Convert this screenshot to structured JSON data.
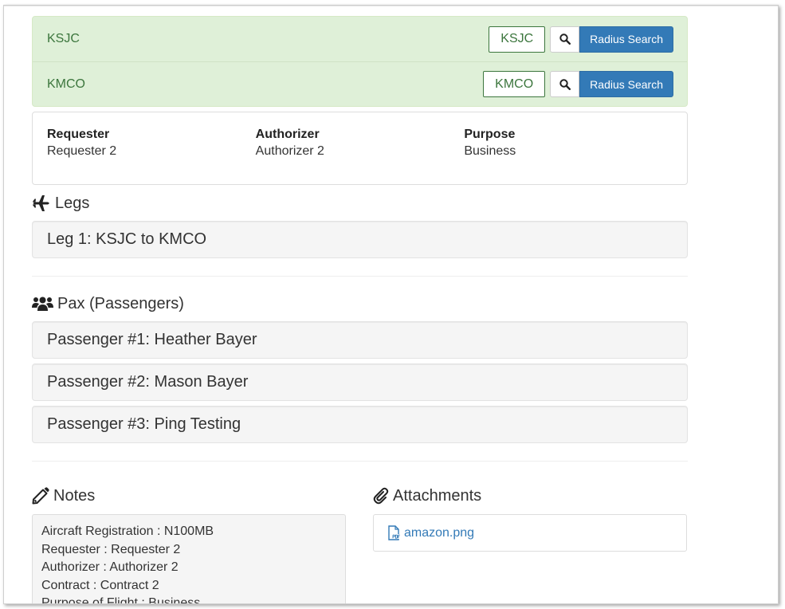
{
  "airports": [
    {
      "code": "KSJC",
      "input_value": "KSJC",
      "radius_label": "Radius Search"
    },
    {
      "code": "KMCO",
      "input_value": "KMCO",
      "radius_label": "Radius Search"
    }
  ],
  "trip_info": {
    "requester_label": "Requester",
    "requester_value": "Requester 2",
    "authorizer_label": "Authorizer",
    "authorizer_value": "Authorizer 2",
    "purpose_label": "Purpose",
    "purpose_value": "Business"
  },
  "legs": {
    "heading": "Legs",
    "icon": "plane-icon",
    "items": [
      "Leg 1: KSJC to KMCO"
    ]
  },
  "pax": {
    "heading": "Pax (Passengers)",
    "icon": "users-icon",
    "items": [
      "Passenger #1: Heather Bayer",
      "Passenger #2: Mason Bayer",
      "Passenger #3: Ping Testing"
    ]
  },
  "notes": {
    "heading": "Notes",
    "icon": "pencil-icon",
    "lines": [
      "Aircraft Registration : N100MB",
      "Requester : Requester 2",
      "Authorizer : Authorizer 2",
      "Contract : Contract 2",
      "Purpose of Flight : Business"
    ]
  },
  "attachments": {
    "heading": "Attachments",
    "icon": "paperclip-icon",
    "files": [
      {
        "name": "amazon.png",
        "icon": "pdf-file-icon"
      }
    ]
  },
  "colors": {
    "success_bg": "#dff0d8",
    "success_text": "#3c763d",
    "primary": "#337ab7",
    "well_bg": "#f5f5f5"
  }
}
